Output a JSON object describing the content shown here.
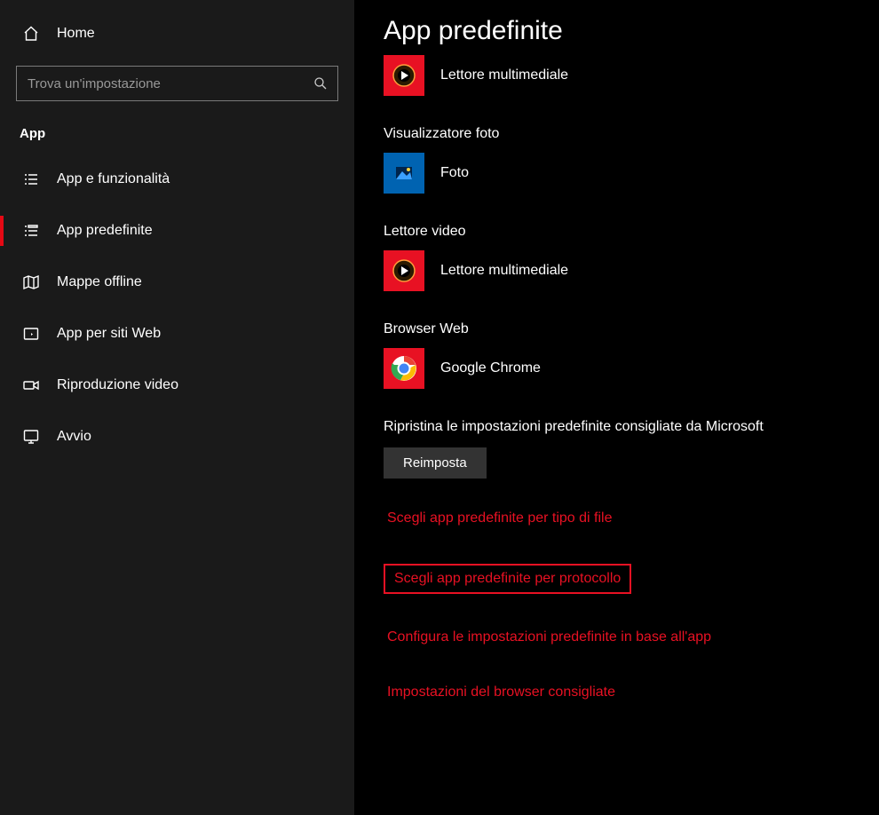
{
  "sidebar": {
    "home_label": "Home",
    "search_placeholder": "Trova un'impostazione",
    "section_label": "App",
    "items": [
      {
        "label": "App e funzionalità"
      },
      {
        "label": "App predefinite"
      },
      {
        "label": "Mappe offline"
      },
      {
        "label": "App per siti Web"
      },
      {
        "label": "Riproduzione video"
      },
      {
        "label": "Avvio"
      }
    ]
  },
  "main": {
    "title": "App predefinite",
    "apps": [
      {
        "category": "",
        "name": "Lettore multimediale",
        "icon": "media-player"
      },
      {
        "category": "Visualizzatore foto",
        "name": "Foto",
        "icon": "photos"
      },
      {
        "category": "Lettore video",
        "name": "Lettore multimediale",
        "icon": "media-player"
      },
      {
        "category": "Browser Web",
        "name": "Google Chrome",
        "icon": "chrome"
      }
    ],
    "reset": {
      "text": "Ripristina le impostazioni predefinite consigliate da Microsoft",
      "button": "Reimposta"
    },
    "links": [
      "Scegli app predefinite per tipo di file",
      "Scegli app predefinite per protocollo",
      "Configura le impostazioni predefinite in base all'app",
      "Impostazioni del browser consigliate"
    ],
    "highlighted_link_index": 1
  }
}
